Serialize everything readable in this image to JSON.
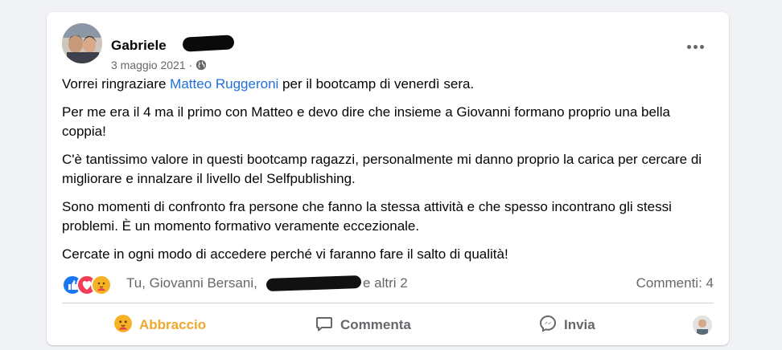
{
  "post": {
    "author": "Gabriele",
    "date": "3 maggio 2021 ·",
    "audience_icon": "globe-icon",
    "more_icon": "ellipsis-icon",
    "paragraphs": {
      "p1_before": "Vorrei ringraziare ",
      "p1_link": "Matteo Ruggeroni",
      "p1_after": " per il bootcamp di venerdì sera.",
      "p2": "Per me era il 4 ma il primo con Matteo e devo dire che insieme a Giovanni formano proprio una bella coppia!",
      "p3": "C'è tantissimo valore in questi bootcamp ragazzi, personalmente mi danno proprio la carica per cercare di migliorare e innalzare il livello del Selfpublishing.",
      "p4": "Sono momenti di confronto fra persone che fanno la stessa attività e che spesso incontrano gli stessi problemi. È un momento formativo veramente eccezionale.",
      "p5": "Cercate in ogni modo di accedere perché vi faranno fare il salto di qualità!"
    }
  },
  "reactions": {
    "icons": [
      "like-icon",
      "love-icon",
      "care-icon"
    ],
    "names": "Tu, Giovanni Bersani,",
    "tail": "e altri 2",
    "comments": "Commenti: 4"
  },
  "actions": {
    "care_label": "Abbraccio",
    "comment_label": "Commenta",
    "share_label": "Invia"
  },
  "colors": {
    "link": "#216fdb",
    "care": "#f0a82f",
    "muted": "#65676b",
    "like": "#1877f2",
    "love": "#f33e58"
  }
}
